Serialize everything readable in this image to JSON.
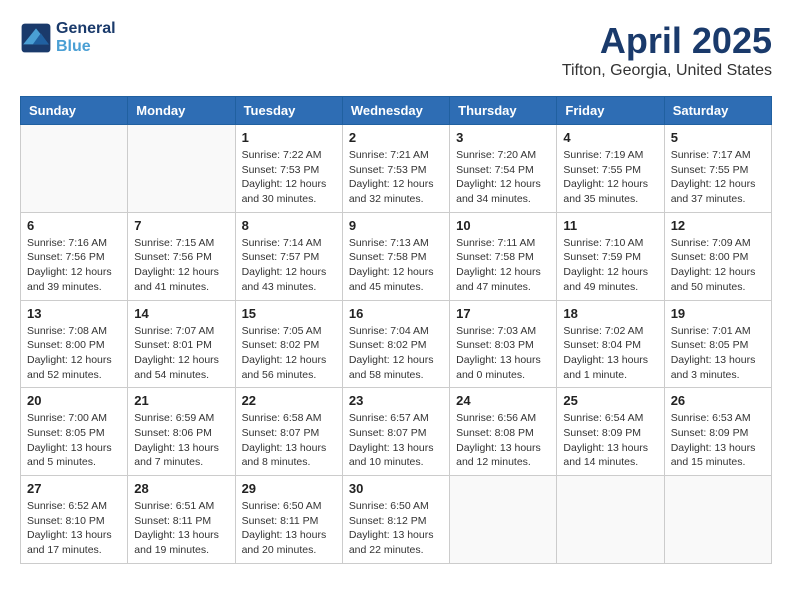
{
  "header": {
    "logo_line1": "General",
    "logo_line2": "Blue",
    "month": "April 2025",
    "location": "Tifton, Georgia, United States"
  },
  "weekdays": [
    "Sunday",
    "Monday",
    "Tuesday",
    "Wednesday",
    "Thursday",
    "Friday",
    "Saturday"
  ],
  "weeks": [
    [
      {
        "day": "",
        "text": ""
      },
      {
        "day": "",
        "text": ""
      },
      {
        "day": "1",
        "text": "Sunrise: 7:22 AM\nSunset: 7:53 PM\nDaylight: 12 hours and 30 minutes."
      },
      {
        "day": "2",
        "text": "Sunrise: 7:21 AM\nSunset: 7:53 PM\nDaylight: 12 hours and 32 minutes."
      },
      {
        "day": "3",
        "text": "Sunrise: 7:20 AM\nSunset: 7:54 PM\nDaylight: 12 hours and 34 minutes."
      },
      {
        "day": "4",
        "text": "Sunrise: 7:19 AM\nSunset: 7:55 PM\nDaylight: 12 hours and 35 minutes."
      },
      {
        "day": "5",
        "text": "Sunrise: 7:17 AM\nSunset: 7:55 PM\nDaylight: 12 hours and 37 minutes."
      }
    ],
    [
      {
        "day": "6",
        "text": "Sunrise: 7:16 AM\nSunset: 7:56 PM\nDaylight: 12 hours and 39 minutes."
      },
      {
        "day": "7",
        "text": "Sunrise: 7:15 AM\nSunset: 7:56 PM\nDaylight: 12 hours and 41 minutes."
      },
      {
        "day": "8",
        "text": "Sunrise: 7:14 AM\nSunset: 7:57 PM\nDaylight: 12 hours and 43 minutes."
      },
      {
        "day": "9",
        "text": "Sunrise: 7:13 AM\nSunset: 7:58 PM\nDaylight: 12 hours and 45 minutes."
      },
      {
        "day": "10",
        "text": "Sunrise: 7:11 AM\nSunset: 7:58 PM\nDaylight: 12 hours and 47 minutes."
      },
      {
        "day": "11",
        "text": "Sunrise: 7:10 AM\nSunset: 7:59 PM\nDaylight: 12 hours and 49 minutes."
      },
      {
        "day": "12",
        "text": "Sunrise: 7:09 AM\nSunset: 8:00 PM\nDaylight: 12 hours and 50 minutes."
      }
    ],
    [
      {
        "day": "13",
        "text": "Sunrise: 7:08 AM\nSunset: 8:00 PM\nDaylight: 12 hours and 52 minutes."
      },
      {
        "day": "14",
        "text": "Sunrise: 7:07 AM\nSunset: 8:01 PM\nDaylight: 12 hours and 54 minutes."
      },
      {
        "day": "15",
        "text": "Sunrise: 7:05 AM\nSunset: 8:02 PM\nDaylight: 12 hours and 56 minutes."
      },
      {
        "day": "16",
        "text": "Sunrise: 7:04 AM\nSunset: 8:02 PM\nDaylight: 12 hours and 58 minutes."
      },
      {
        "day": "17",
        "text": "Sunrise: 7:03 AM\nSunset: 8:03 PM\nDaylight: 13 hours and 0 minutes."
      },
      {
        "day": "18",
        "text": "Sunrise: 7:02 AM\nSunset: 8:04 PM\nDaylight: 13 hours and 1 minute."
      },
      {
        "day": "19",
        "text": "Sunrise: 7:01 AM\nSunset: 8:05 PM\nDaylight: 13 hours and 3 minutes."
      }
    ],
    [
      {
        "day": "20",
        "text": "Sunrise: 7:00 AM\nSunset: 8:05 PM\nDaylight: 13 hours and 5 minutes."
      },
      {
        "day": "21",
        "text": "Sunrise: 6:59 AM\nSunset: 8:06 PM\nDaylight: 13 hours and 7 minutes."
      },
      {
        "day": "22",
        "text": "Sunrise: 6:58 AM\nSunset: 8:07 PM\nDaylight: 13 hours and 8 minutes."
      },
      {
        "day": "23",
        "text": "Sunrise: 6:57 AM\nSunset: 8:07 PM\nDaylight: 13 hours and 10 minutes."
      },
      {
        "day": "24",
        "text": "Sunrise: 6:56 AM\nSunset: 8:08 PM\nDaylight: 13 hours and 12 minutes."
      },
      {
        "day": "25",
        "text": "Sunrise: 6:54 AM\nSunset: 8:09 PM\nDaylight: 13 hours and 14 minutes."
      },
      {
        "day": "26",
        "text": "Sunrise: 6:53 AM\nSunset: 8:09 PM\nDaylight: 13 hours and 15 minutes."
      }
    ],
    [
      {
        "day": "27",
        "text": "Sunrise: 6:52 AM\nSunset: 8:10 PM\nDaylight: 13 hours and 17 minutes."
      },
      {
        "day": "28",
        "text": "Sunrise: 6:51 AM\nSunset: 8:11 PM\nDaylight: 13 hours and 19 minutes."
      },
      {
        "day": "29",
        "text": "Sunrise: 6:50 AM\nSunset: 8:11 PM\nDaylight: 13 hours and 20 minutes."
      },
      {
        "day": "30",
        "text": "Sunrise: 6:50 AM\nSunset: 8:12 PM\nDaylight: 13 hours and 22 minutes."
      },
      {
        "day": "",
        "text": ""
      },
      {
        "day": "",
        "text": ""
      },
      {
        "day": "",
        "text": ""
      }
    ]
  ]
}
